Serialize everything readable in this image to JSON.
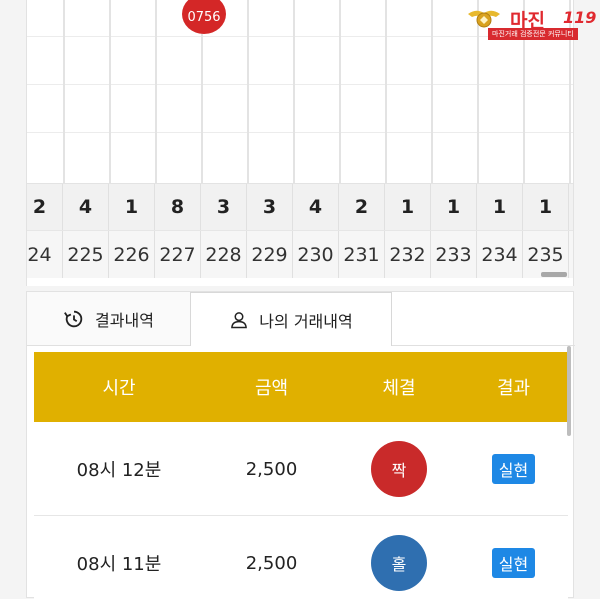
{
  "top_ball": {
    "label": "0756",
    "color": "#d42727"
  },
  "logo": {
    "text": "마진",
    "suffix": "119",
    "sub": "마진거래 검증전문 커뮤니티",
    "color": "#e0292f"
  },
  "grid": {
    "counts": [
      "2",
      "4",
      "1",
      "8",
      "3",
      "3",
      "4",
      "2",
      "1",
      "1",
      "1",
      "1"
    ],
    "labels": [
      "24",
      "225",
      "226",
      "227",
      "228",
      "229",
      "230",
      "231",
      "232",
      "233",
      "234",
      "235"
    ]
  },
  "tabs": [
    {
      "label": "결과내역",
      "icon": "history-icon"
    },
    {
      "label": "나의 거래내역",
      "icon": "user-icon"
    }
  ],
  "table": {
    "header_color": "#e0b000",
    "columns": [
      "시간",
      "금액",
      "체결",
      "결과"
    ],
    "rows": [
      {
        "time": "08시 12분",
        "amount": "2,500",
        "pick": "짝",
        "pick_color": "#c92a2a",
        "result": "실현"
      },
      {
        "time": "08시 11분",
        "amount": "2,500",
        "pick": "홀",
        "pick_color": "#2f6fb0",
        "result": "실현"
      }
    ]
  }
}
